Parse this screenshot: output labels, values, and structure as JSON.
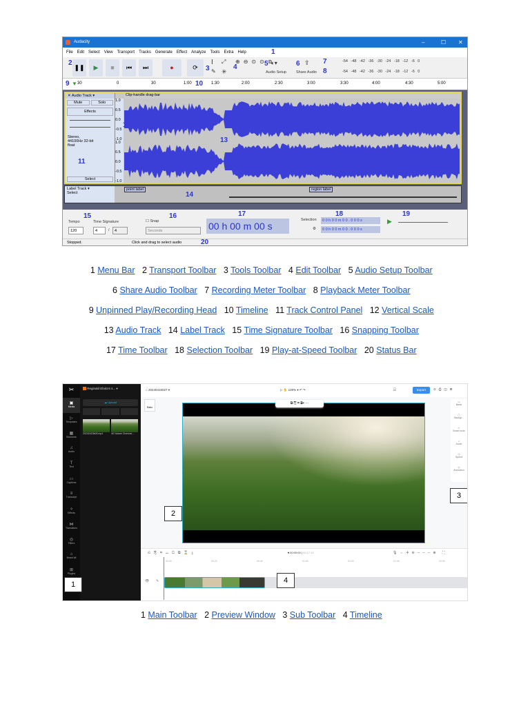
{
  "audacity": {
    "title": "Audacity",
    "menu": [
      "File",
      "Edit",
      "Select",
      "View",
      "Transport",
      "Tracks",
      "Generate",
      "Effect",
      "Analyze",
      "Tools",
      "Extra",
      "Help"
    ],
    "audio_setup": "Audio Setup",
    "share_audio": "Share Audio",
    "meter_ticks": [
      "-54",
      "-48",
      "-42",
      "-36",
      "-30",
      "-24",
      "-18",
      "-12",
      "-6",
      "0"
    ],
    "ruler": [
      "30",
      "0",
      "30",
      "1:00",
      "1:30",
      "2:00",
      "2:30",
      "3:00",
      "3:30",
      "4:00",
      "4:30",
      "5:00"
    ],
    "track_name": "Audio Track",
    "clip_bar": "Clip-handle drag-bar",
    "mute": "Mute",
    "solo": "Solo",
    "effects": "Effects",
    "track_info": "Stereo, 44100Hz 32-bit float",
    "select": "Select",
    "scale": [
      "1.0",
      "0.5",
      "0.0",
      "-0.5",
      "-1.0"
    ],
    "label_track": "Label Track",
    "point_label": "point label",
    "region_label": "region label",
    "tempo_label": "Tempo",
    "tempo": "120",
    "time_sig_label": "Time Signature",
    "ts_num": "4",
    "ts_den": "4",
    "snap": "Snap",
    "snap_unit": "Seconds",
    "time": "00 h 00 m 00 s",
    "selection_label": "Selection",
    "sel_start": "0 0 h 0 0 m 0 0 . 0 0 0 s",
    "sel_end": "0 0 h 0 0 m 0 0 . 0 0 0 s",
    "status_left": "Stopped.",
    "status_mid": "Click and drag to select audio",
    "callouts": [
      "1",
      "2",
      "3",
      "4",
      "5",
      "6",
      "7",
      "8",
      "9",
      "10",
      "11",
      "12",
      "13",
      "14",
      "15",
      "16",
      "17",
      "18",
      "19",
      "20"
    ]
  },
  "captions1": [
    [
      {
        "n": "1",
        "t": "Menu Bar"
      },
      {
        "n": "2",
        "t": "Transport Toolbar"
      },
      {
        "n": "3",
        "t": "Tools Toolbar"
      },
      {
        "n": "4",
        "t": "Edit Toolbar"
      },
      {
        "n": "5",
        "t": "Audio Setup Toolbar"
      }
    ],
    [
      {
        "n": "6",
        "t": "Share Audio Toolbar"
      },
      {
        "n": "7",
        "t": "Recording Meter Toolbar"
      },
      {
        "n": "8",
        "t": "Playback Meter Toolbar"
      }
    ],
    [
      {
        "n": "9",
        "t": "Unpinned Play/Recording Head"
      },
      {
        "n": "10",
        "t": "Timeline"
      },
      {
        "n": "11",
        "t": "Track Control Panel"
      },
      {
        "n": "12",
        "t": "Vertical Scale"
      }
    ],
    [
      {
        "n": "13",
        "t": "Audio Track"
      },
      {
        "n": "14",
        "t": "Label Track"
      },
      {
        "n": "15",
        "t": "Time Signature Toolbar"
      },
      {
        "n": "16",
        "t": "Snapping Toolbar"
      }
    ],
    [
      {
        "n": "17",
        "t": "Time Toolbar"
      },
      {
        "n": "18",
        "t": "Selection Toolbar"
      },
      {
        "n": "19",
        "t": "Play-at-Speed Toolbar"
      },
      {
        "n": "20",
        "t": "Status Bar"
      }
    ]
  ],
  "capcut": {
    "workspace": "Reginald Ebola's s...",
    "project": "20240416027",
    "zoom": "100%",
    "export": "Export",
    "upload": "Upload",
    "ratio": "Ratio",
    "media": [
      "20240415b05.mp4",
      "4K Nature Cinemat..."
    ],
    "rail": [
      "Media",
      "Templates",
      "Elements",
      "Audio",
      "Text",
      "Captions",
      "Transcript",
      "Effects",
      "Transitions",
      "Filters",
      "Brand kit",
      "Plugins"
    ],
    "right": [
      "Basic",
      "Backgr...",
      "Smart tools",
      "Audio",
      "Speed",
      "Animation"
    ],
    "timecode": "00:00:00",
    "duration": "00:17:13",
    "ruler": [
      "00:00",
      "00:20",
      "00:40",
      "01:00",
      "01:20",
      "01:40",
      "02:00"
    ],
    "callouts": [
      "1",
      "2",
      "3",
      "4"
    ]
  },
  "captions2": [
    [
      {
        "n": "1",
        "t": "Main Toolbar"
      },
      {
        "n": "2",
        "t": "Preview Window"
      },
      {
        "n": "3",
        "t": "Sub Toolbar"
      },
      {
        "n": "4",
        "t": "Timeline"
      }
    ]
  ]
}
